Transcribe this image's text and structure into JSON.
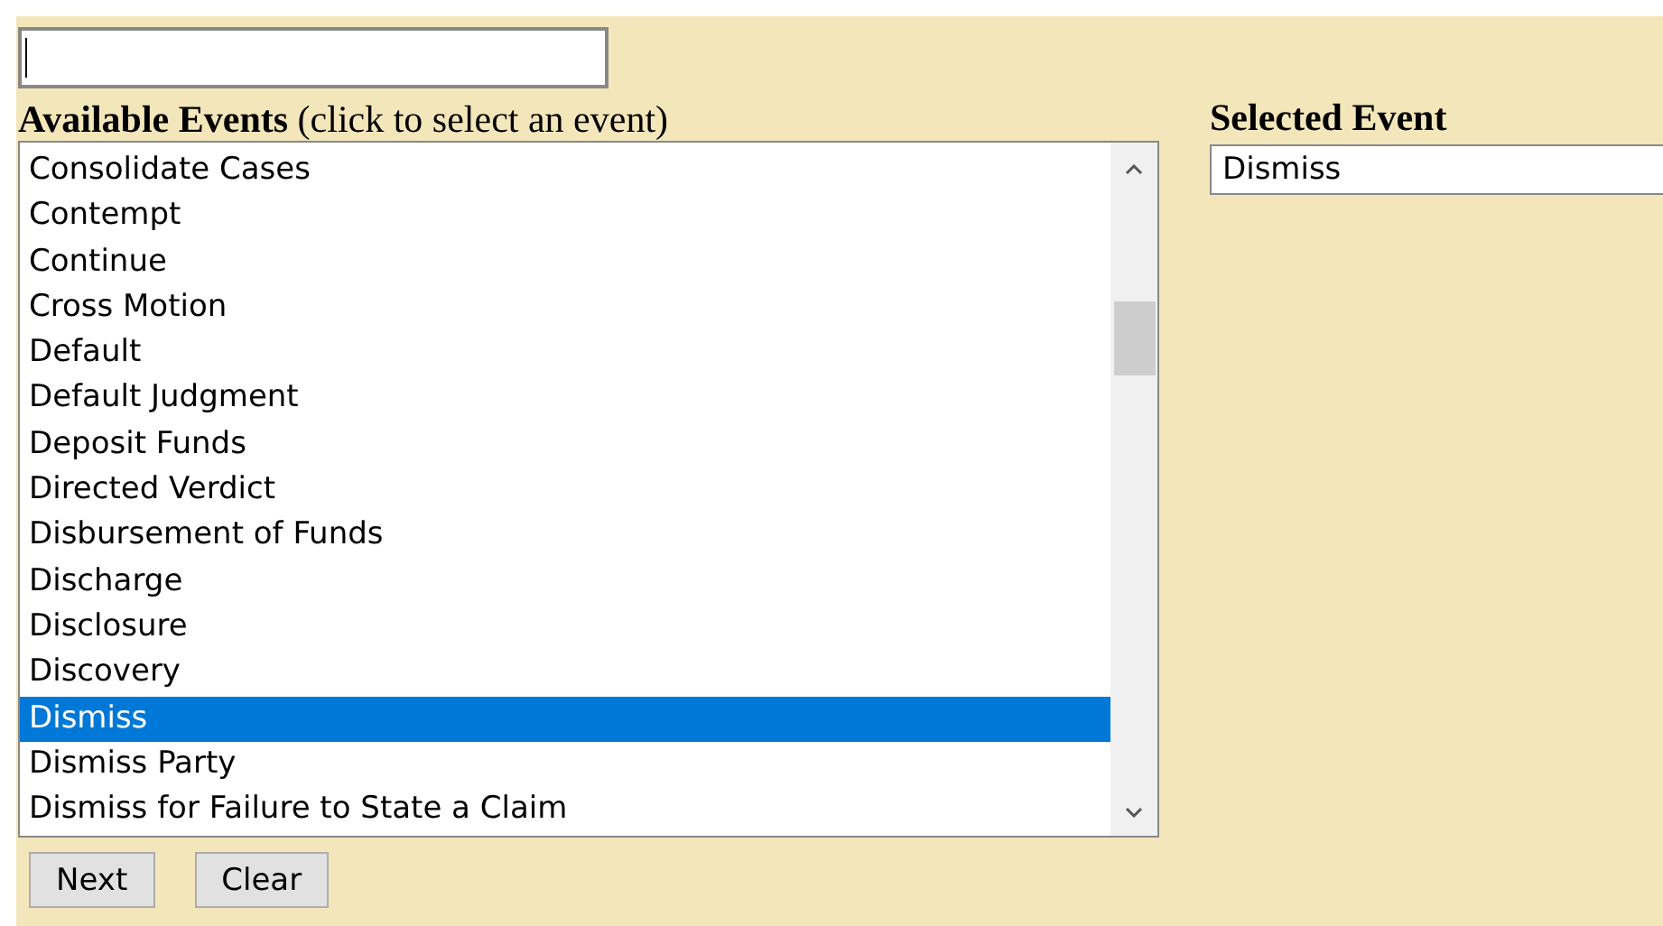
{
  "search": {
    "focused": true
  },
  "available_events": {
    "heading": "Available Events",
    "hint": "(click to select an event)",
    "items": [
      {
        "label": "Consolidate Cases",
        "selected": false
      },
      {
        "label": "Contempt",
        "selected": false
      },
      {
        "label": "Continue",
        "selected": false
      },
      {
        "label": "Cross Motion",
        "selected": false
      },
      {
        "label": "Default",
        "selected": false
      },
      {
        "label": "Default Judgment",
        "selected": false
      },
      {
        "label": "Deposit Funds",
        "selected": false
      },
      {
        "label": "Directed Verdict",
        "selected": false
      },
      {
        "label": "Disbursement of Funds",
        "selected": false
      },
      {
        "label": "Discharge",
        "selected": false
      },
      {
        "label": "Disclosure",
        "selected": false
      },
      {
        "label": "Discovery",
        "selected": false
      },
      {
        "label": "Dismiss",
        "selected": true
      },
      {
        "label": "Dismiss Party",
        "selected": false
      },
      {
        "label": "Dismiss for Failure to State a Claim",
        "selected": false
      }
    ]
  },
  "selected_event": {
    "heading": "Selected Event",
    "value": "Dismiss"
  },
  "buttons": [
    "Next",
    "Clear"
  ]
}
